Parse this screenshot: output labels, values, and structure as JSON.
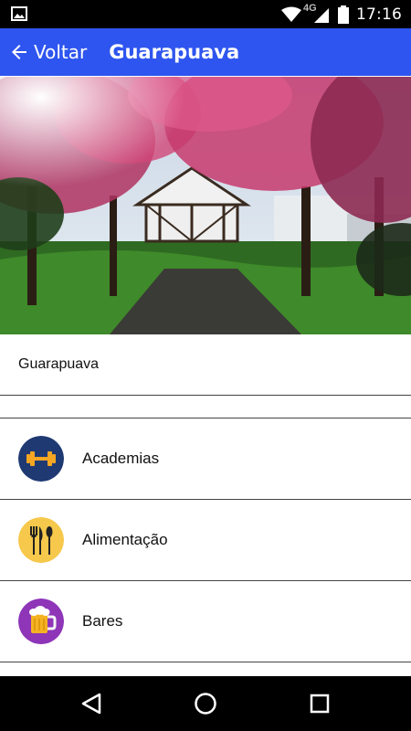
{
  "status_bar": {
    "network": "4G",
    "time": "17:16"
  },
  "app_bar": {
    "back_label": "Voltar",
    "title": "Guarapuava"
  },
  "city": {
    "name": "Guarapuava"
  },
  "categories": [
    {
      "label": "Academias",
      "icon": "dumbbell-icon",
      "color": "#1f3a73",
      "accent": "#f5a623"
    },
    {
      "label": "Alimentação",
      "icon": "fork-knife-spoon-icon",
      "color": "#f6c84b",
      "accent": "#222222"
    },
    {
      "label": "Bares",
      "icon": "beer-mug-icon",
      "color": "#8e35b8",
      "accent": "#f5b323"
    }
  ],
  "colors": {
    "app_bar": "#2e55ef",
    "status_bar": "#000000",
    "nav_bar": "#000000"
  }
}
